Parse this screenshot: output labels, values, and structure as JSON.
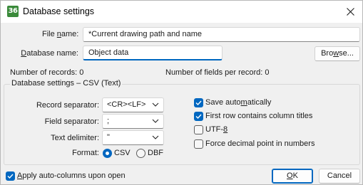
{
  "window": {
    "title": "Database settings",
    "app_icon_text": "36",
    "close_icon": "close-icon"
  },
  "file_name": {
    "label_pre": "File ",
    "label_key": "n",
    "label_post": "ame:",
    "value": "*Current drawing path and name"
  },
  "database_name": {
    "label_key": "D",
    "label_post": "atabase name:",
    "value": "Object data"
  },
  "browse_button": {
    "label_pre": "Bro",
    "label_key": "w",
    "label_post": "se..."
  },
  "records": {
    "count_text": "Number of records: 0",
    "fields_text": "Number of fields per record: 0"
  },
  "csv_group": {
    "title": "Database settings – CSV (Text)",
    "record_separator_label": "Record separator:",
    "record_separator_value": "<CR><LF>",
    "field_separator_label": "Field separator:",
    "field_separator_value": ";",
    "text_delimiter_label": "Text delimiter:",
    "text_delimiter_value": "\"",
    "format_label": "Format:",
    "format_options": [
      {
        "label": "CSV",
        "selected": true
      },
      {
        "label": "DBF",
        "selected": false
      }
    ],
    "options": [
      {
        "label_pre": "Save auto",
        "label_key": "m",
        "label_post": "atically",
        "checked": true
      },
      {
        "label_pre": "First row contains column titles",
        "label_key": "",
        "label_post": "",
        "checked": true
      },
      {
        "label_pre": "UTF-",
        "label_key": "8",
        "label_post": "",
        "checked": false
      },
      {
        "label_pre": "Force decimal point in numbers",
        "label_key": "",
        "label_post": "",
        "checked": false
      }
    ]
  },
  "bottom": {
    "auto_columns_key": "A",
    "auto_columns_post": "pply auto-columns upon open",
    "auto_columns_checked": true,
    "ok_key": "O",
    "ok_post": "K",
    "cancel_label": "Cancel"
  },
  "colors": {
    "accent": "#0067c0",
    "app_icon_bg": "#3a8a3a",
    "background": "#f0f0f0"
  }
}
